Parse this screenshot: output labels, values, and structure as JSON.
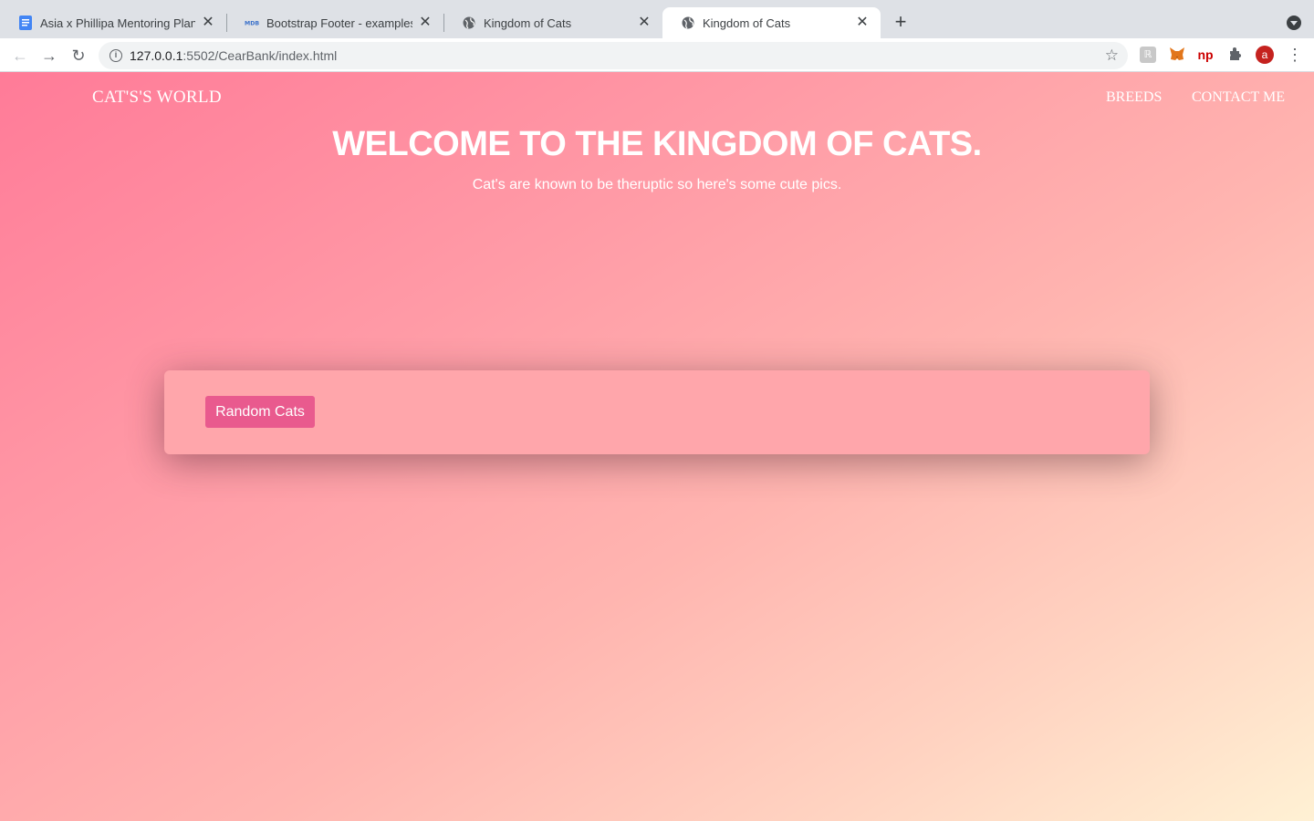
{
  "browser": {
    "tabs": [
      {
        "title": "Asia x Phillipa Mentoring Plan -",
        "icon": "google-docs-icon",
        "active": false
      },
      {
        "title": "Bootstrap Footer - examples &",
        "icon": "mdb-icon",
        "active": false
      },
      {
        "title": "Kingdom of Cats",
        "icon": "globe-icon",
        "active": false
      },
      {
        "title": "Kingdom of Cats",
        "icon": "globe-icon",
        "active": true
      }
    ],
    "new_tab_label": "+",
    "address": {
      "host": "127.0.0.1",
      "path": ":5502/CearBank/index.html"
    },
    "avatar_letter": "a",
    "extension_np_label": "np"
  },
  "site": {
    "brand": "CAT'S'S WORLD",
    "nav": [
      {
        "label": "BREEDS"
      },
      {
        "label": "CONTACT ME"
      }
    ],
    "hero": {
      "title": "WELCOME TO THE KINGDOM OF CATS.",
      "subtitle": "Cat's are known to be theruptic so here's some cute pics."
    },
    "card": {
      "button_label": "Random Cats"
    }
  },
  "colors": {
    "gradient_start": "#ff7b98",
    "gradient_end": "#fff1d4",
    "card_bg": "#ffa6ab",
    "button_bg": "#e95a8e"
  }
}
